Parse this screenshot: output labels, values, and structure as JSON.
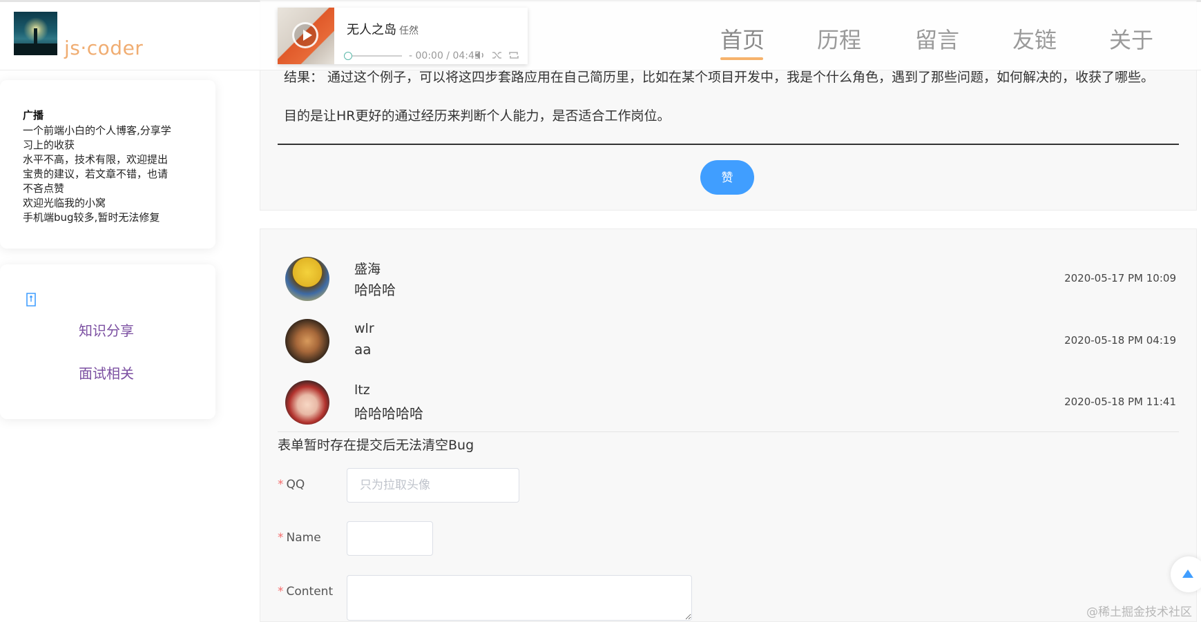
{
  "brand": {
    "name": "js·coder"
  },
  "nav": {
    "items": [
      {
        "label": "首页",
        "active": true
      },
      {
        "label": "历程"
      },
      {
        "label": "留言"
      },
      {
        "label": "友链"
      },
      {
        "label": "关于"
      }
    ],
    "accent": "#f6b26b"
  },
  "player": {
    "song": "无人之岛",
    "artist": "任然",
    "time": "- 00:00 / 04:45",
    "progress": 0,
    "icons": [
      "play-icon",
      "volume-icon",
      "shuffle-icon",
      "repeat-icon"
    ]
  },
  "sidebar": {
    "broadcast": {
      "title": "广播",
      "lines": [
        "一个前端小白的个人博客,分享学",
        "习上的收获",
        "水平不高，技术有限，欢迎提出",
        "宝贵的建议，若文章不错，也请",
        "不吝点赞",
        "欢迎光临我的小窝",
        "手机端bug较多,暂时无法修复"
      ]
    },
    "categories": {
      "icon": "tag-icon",
      "items": [
        "知识分享",
        "面试相关"
      ]
    }
  },
  "article": {
    "paragraphs": [
      "结果：  通过这个例子，可以将这四步套路应用在自己简历里，比如在某个项目开发中，我是个什么角色，遇到了那些问题，如何解决的，收获了哪些。",
      "目的是让HR更好的通过经历来判断个人能力，是否适合工作岗位。"
    ],
    "like_label": "赞",
    "like_color": "#409eff"
  },
  "comments": [
    {
      "name": "盛海",
      "text": "哈哈哈",
      "time": "2020-05-17 PM 10:09"
    },
    {
      "name": "wlr",
      "text": "aa",
      "time": "2020-05-18 PM 04:19"
    },
    {
      "name": "ltz",
      "text": "哈哈哈哈哈",
      "time": "2020-05-18 PM 11:41"
    }
  ],
  "form": {
    "notice": "表单暂时存在提交后无法清空Bug",
    "required_mark": "*",
    "fields": [
      {
        "label": "QQ",
        "placeholder": "只为拉取头像",
        "value": ""
      },
      {
        "label": "Name",
        "placeholder": "",
        "value": ""
      },
      {
        "label": "Content",
        "placeholder": "",
        "value": ""
      }
    ]
  },
  "backtop": {
    "icon": "caret-up-icon"
  },
  "watermark": "@稀土掘金技术社区"
}
